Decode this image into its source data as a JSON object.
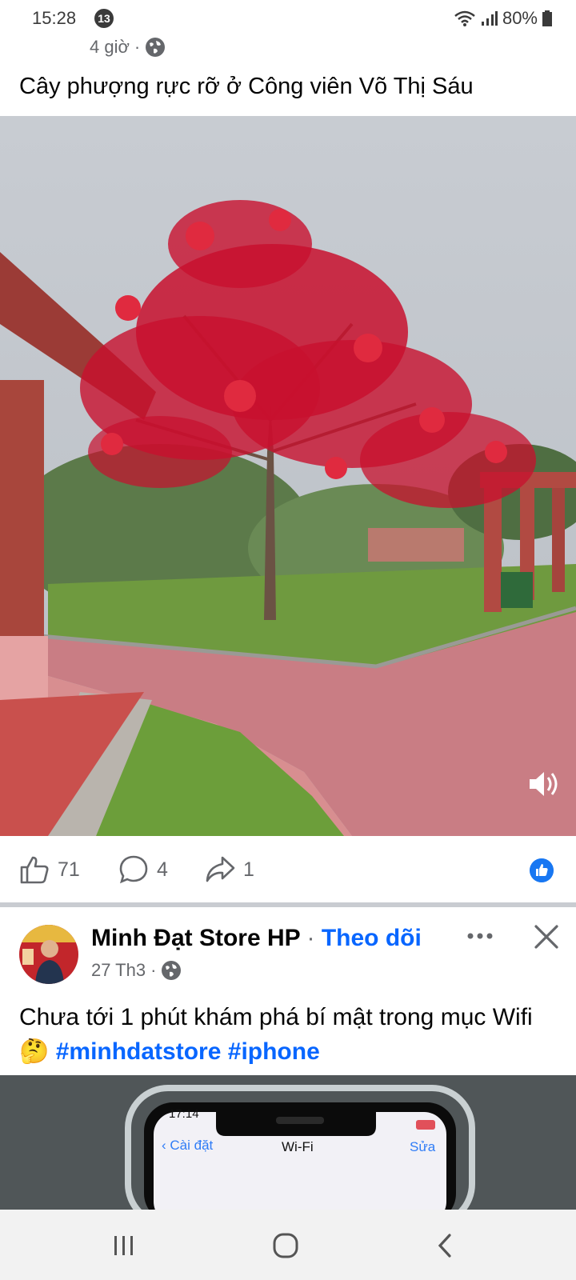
{
  "status_bar": {
    "time": "15:28",
    "notification_count": "13",
    "battery": "80%"
  },
  "post1": {
    "time": "4 giờ",
    "separator": "·",
    "text": "Cây phượng rực rỡ ở Công viên Võ Thị Sáu",
    "likes": "71",
    "comments": "4",
    "shares": "1"
  },
  "post2": {
    "author": "Minh Đạt Store HP",
    "separator": "·",
    "follow_label": "Theo dõi",
    "time": "27 Th3",
    "text": "Chưa tới 1 phút khám phá bí mật trong mục Wifi",
    "emoji": "🤔",
    "hashtags": [
      "#minhdatstore",
      "#iphone"
    ],
    "preview": {
      "phone_time": "17:14",
      "back_label": "Cài đặt",
      "title": "Wi-Fi",
      "edit_label": "Sửa"
    }
  },
  "icons": [
    "globe-icon",
    "speaker-icon",
    "like-icon",
    "comment-icon",
    "share-icon",
    "like-count-icon",
    "more-icon",
    "close-icon",
    "recent-apps-icon",
    "home-icon",
    "back-icon"
  ],
  "colors": {
    "accent": "#0866ff",
    "like_blue": "#1877f2",
    "secondary_text": "#65676b"
  }
}
